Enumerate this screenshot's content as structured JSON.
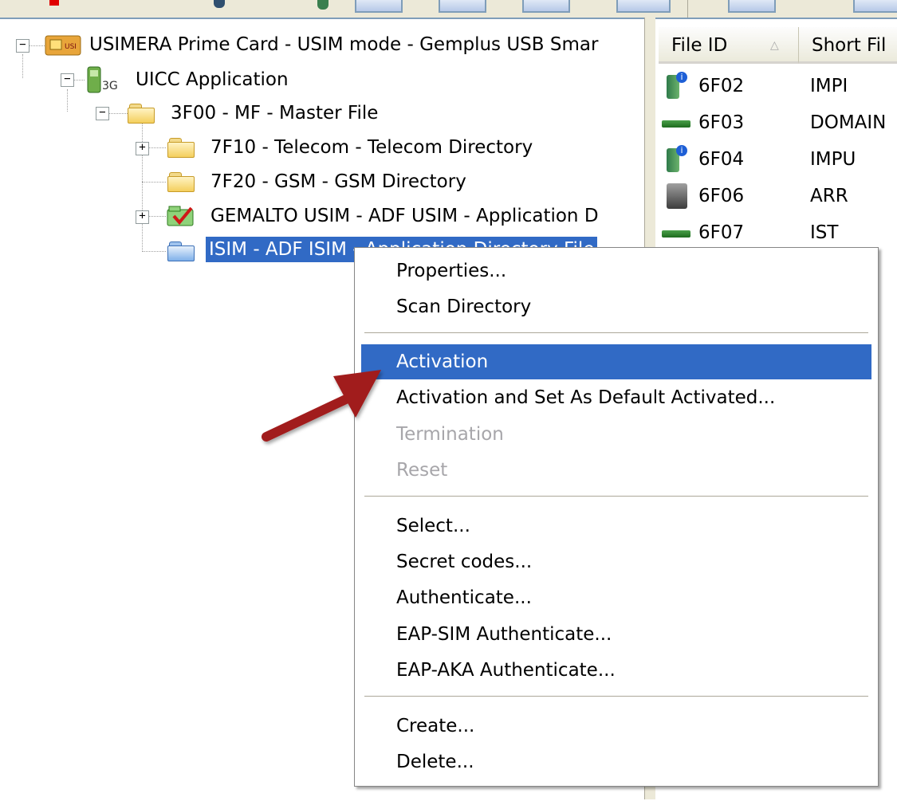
{
  "tree": {
    "root_label": "USIMERA Prime Card - USIM mode - Gemplus USB Smar",
    "uicc_label": "UICC Application",
    "mf_label": "3F00 - MF - Master File",
    "telecom_label": "7F10 - Telecom - Telecom Directory",
    "gsm_label": "7F20 - GSM - GSM Directory",
    "usim_label": "GEMALTO USIM - ADF USIM - Application D",
    "isim_label": "ISIM - ADF ISIM - Application Directory File"
  },
  "list": {
    "columns": [
      "File ID",
      "Short Fil"
    ],
    "rows": [
      {
        "file_id": "6F02",
        "short": "IMPI",
        "icon": "user-info-icon"
      },
      {
        "file_id": "6F03",
        "short": "DOMAIN",
        "icon": "chip-icon"
      },
      {
        "file_id": "6F04",
        "short": "IMPU",
        "icon": "user-info-icon"
      },
      {
        "file_id": "6F06",
        "short": "ARR",
        "icon": "safe-icon"
      },
      {
        "file_id": "6F07",
        "short": "IST",
        "icon": "chip-icon"
      }
    ]
  },
  "menu": {
    "properties": "Properties...",
    "scan_directory": "Scan Directory",
    "activation": "Activation",
    "activation_default": "Activation and Set As Default Activated...",
    "termination": "Termination",
    "reset": "Reset",
    "select": "Select...",
    "secret_codes": "Secret codes...",
    "authenticate": "Authenticate...",
    "eap_sim": "EAP-SIM Authenticate...",
    "eap_aka": "EAP-AKA Authenticate...",
    "create": "Create...",
    "delete": "Delete..."
  },
  "colors": {
    "selection": "#316ac5",
    "arrow": "#a11a1a",
    "disabled_text": "#a7a6aa"
  }
}
